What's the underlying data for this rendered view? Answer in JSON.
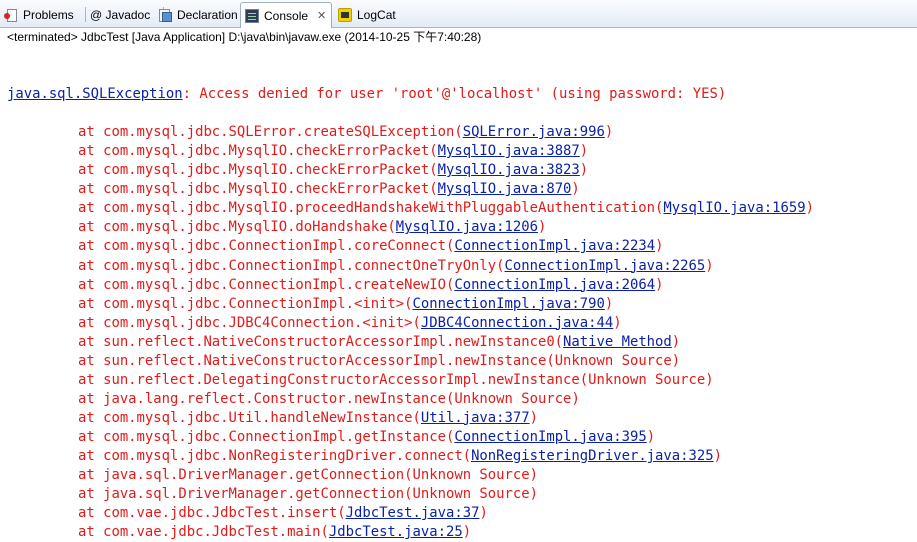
{
  "tabs": [
    {
      "label": "Problems",
      "icon": "problems-icon"
    },
    {
      "label": "@ Javadoc",
      "icon": "javadoc-icon"
    },
    {
      "label": "Declaration",
      "icon": "declaration-icon"
    },
    {
      "label": "Console",
      "icon": "console-icon",
      "close": "✕"
    },
    {
      "label": "LogCat",
      "icon": "logcat-icon"
    }
  ],
  "status": "<terminated> JdbcTest [Java Application] D:\\java\\bin\\javaw.exe (2014-10-25 下午7:40:28)",
  "colors": {
    "error_text": "#e21a1a",
    "link_text": "#0b21a8"
  },
  "console": {
    "exception_class": "java.sql.SQLException",
    "exception_message": ": Access denied for user 'root'@'localhost' (using password: YES)",
    "frames": [
      {
        "method": "at com.mysql.jdbc.SQLError.createSQLException(",
        "source": "SQLError.java:996",
        "linked": true
      },
      {
        "method": "at com.mysql.jdbc.MysqlIO.checkErrorPacket(",
        "source": "MysqlIO.java:3887",
        "linked": true
      },
      {
        "method": "at com.mysql.jdbc.MysqlIO.checkErrorPacket(",
        "source": "MysqlIO.java:3823",
        "linked": true
      },
      {
        "method": "at com.mysql.jdbc.MysqlIO.checkErrorPacket(",
        "source": "MysqlIO.java:870",
        "linked": true
      },
      {
        "method": "at com.mysql.jdbc.MysqlIO.proceedHandshakeWithPluggableAuthentication(",
        "source": "MysqlIO.java:1659",
        "linked": true
      },
      {
        "method": "at com.mysql.jdbc.MysqlIO.doHandshake(",
        "source": "MysqlIO.java:1206",
        "linked": true
      },
      {
        "method": "at com.mysql.jdbc.ConnectionImpl.coreConnect(",
        "source": "ConnectionImpl.java:2234",
        "linked": true
      },
      {
        "method": "at com.mysql.jdbc.ConnectionImpl.connectOneTryOnly(",
        "source": "ConnectionImpl.java:2265",
        "linked": true
      },
      {
        "method": "at com.mysql.jdbc.ConnectionImpl.createNewIO(",
        "source": "ConnectionImpl.java:2064",
        "linked": true
      },
      {
        "method": "at com.mysql.jdbc.ConnectionImpl.<init>(",
        "source": "ConnectionImpl.java:790",
        "linked": true
      },
      {
        "method": "at com.mysql.jdbc.JDBC4Connection.<init>(",
        "source": "JDBC4Connection.java:44",
        "linked": true
      },
      {
        "method": "at sun.reflect.NativeConstructorAccessorImpl.newInstance0(",
        "source": "Native Method",
        "linked": true
      },
      {
        "method": "at sun.reflect.NativeConstructorAccessorImpl.newInstance(",
        "source": "Unknown Source",
        "linked": false
      },
      {
        "method": "at sun.reflect.DelegatingConstructorAccessorImpl.newInstance(",
        "source": "Unknown Source",
        "linked": false
      },
      {
        "method": "at java.lang.reflect.Constructor.newInstance(",
        "source": "Unknown Source",
        "linked": false
      },
      {
        "method": "at com.mysql.jdbc.Util.handleNewInstance(",
        "source": "Util.java:377",
        "linked": true
      },
      {
        "method": "at com.mysql.jdbc.ConnectionImpl.getInstance(",
        "source": "ConnectionImpl.java:395",
        "linked": true
      },
      {
        "method": "at com.mysql.jdbc.NonRegisteringDriver.connect(",
        "source": "NonRegisteringDriver.java:325",
        "linked": true
      },
      {
        "method": "at java.sql.DriverManager.getConnection(",
        "source": "Unknown Source",
        "linked": false
      },
      {
        "method": "at java.sql.DriverManager.getConnection(",
        "source": "Unknown Source",
        "linked": false
      },
      {
        "method": "at com.vae.jdbc.JdbcTest.insert(",
        "source": "JdbcTest.java:37",
        "linked": true
      },
      {
        "method": "at com.vae.jdbc.JdbcTest.main(",
        "source": "JdbcTest.java:25",
        "linked": true
      }
    ],
    "close_paren": ")"
  }
}
